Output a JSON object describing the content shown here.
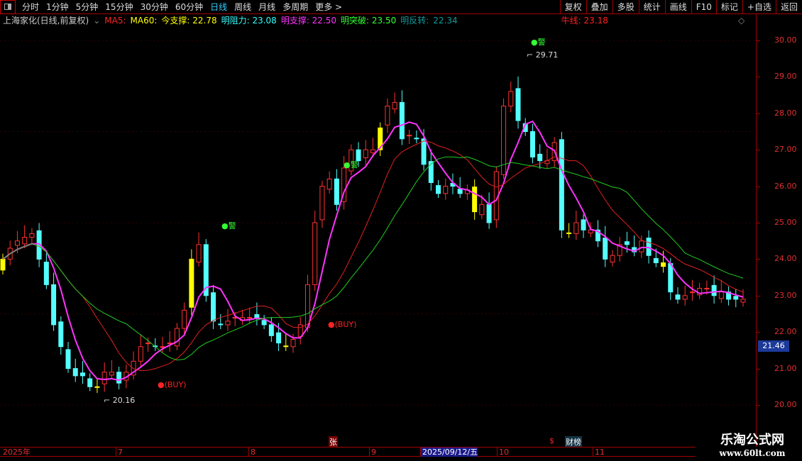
{
  "toolbar": {
    "periods": [
      "分时",
      "1分钟",
      "5分钟",
      "15分钟",
      "30分钟",
      "60分钟",
      "日线",
      "周线",
      "月线",
      "多周期",
      "更多 >"
    ],
    "active": "日线",
    "buttons": [
      "复权",
      "叠加",
      "多股",
      "统计",
      "画线",
      "F10",
      "标记",
      "+自选",
      "返回"
    ]
  },
  "legend": {
    "title": "上海家化(日线,前复权)",
    "ma5": "MA5:",
    "ma60": "MA60:",
    "support": "今支撑: 22.78",
    "resistance": "明阻力: 23.08",
    "next_support": "明支撑: 22.50",
    "breakout": "明突破: 23.50",
    "reversal_label": "明反转:",
    "reversal": "22.34",
    "bull_line": "牛线: 23.18"
  },
  "colors": {
    "up": "#ff3232",
    "down": "#54ffff",
    "ma5": "#ff33ff",
    "ma_mid": "#e02020",
    "ma_long": "#22cc22"
  },
  "price_axis": [
    "30.00",
    "29.00",
    "28.00",
    "27.00",
    "26.00",
    "25.00",
    "24.00",
    "23.00",
    "22.00",
    "21.00",
    "20.00"
  ],
  "current_price": "21.46",
  "annotations": {
    "warn": "●警",
    "high": "29.71",
    "low": "20.16",
    "buy": "●(BUY)"
  },
  "date_axis": [
    "2025年",
    "7",
    "8",
    "9",
    "2025/09/12/五",
    "10",
    "11"
  ],
  "markers": {
    "zhang": "张",
    "s": "$",
    "caibang": "财榜"
  },
  "watermark": {
    "name": "乐淘公式网",
    "url": "www.60lt.com"
  },
  "chart_data": {
    "type": "candlestick",
    "ylim": [
      20,
      30
    ],
    "closes": [
      24.0,
      24.3,
      24.5,
      24.6,
      24.7,
      24.0,
      23.3,
      22.2,
      21.6,
      21.0,
      20.8,
      20.8,
      20.5,
      20.5,
      20.9,
      20.9,
      20.6,
      20.9,
      21.2,
      21.6,
      21.7,
      21.6,
      21.6,
      21.7,
      22.1,
      22.6,
      24.0,
      24.4,
      23.0,
      22.3,
      22.2,
      22.3,
      22.4,
      22.4,
      22.4,
      22.4,
      22.2,
      21.9,
      21.7,
      21.6,
      21.8,
      22.2,
      23.3,
      25.0,
      26.0,
      26.2,
      25.5,
      26.5,
      27.0,
      26.7,
      27.0,
      27.0,
      27.6,
      28.2,
      28.3,
      27.3,
      27.4,
      27.3,
      26.6,
      26.1,
      25.8,
      26.0,
      26.0,
      25.8,
      25.9,
      25.3,
      25.5,
      25.0,
      26.4,
      28.2,
      28.6,
      27.8,
      27.5,
      26.8,
      26.7,
      26.7,
      27.2,
      24.8,
      24.7,
      25.0,
      24.8,
      24.8,
      24.5,
      24.0,
      24.1,
      24.4,
      24.4,
      24.2,
      24.5,
      24.1,
      23.9,
      23.8,
      23.1,
      22.9,
      23.0,
      23.1,
      23.2,
      23.2,
      23.0,
      23.1,
      22.9,
      22.9,
      22.9
    ]
  }
}
